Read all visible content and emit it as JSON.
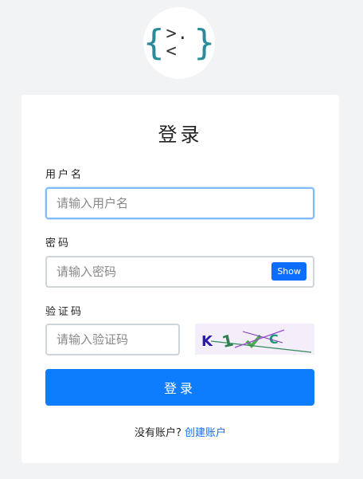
{
  "logo": {
    "left_brace": "{",
    "face": ">.<",
    "right_brace": "}",
    "brace_color": "#2a8c9a"
  },
  "form": {
    "title": "登录",
    "username": {
      "label": "用户名",
      "placeholder": "请输入用户名"
    },
    "password": {
      "label": "密码",
      "placeholder": "请输入密码",
      "show_label": "Show"
    },
    "captcha": {
      "label": "验证码",
      "placeholder": "请输入验证码",
      "image_text": "K 1 ✓ C"
    },
    "submit_label": "登录",
    "footer": {
      "prompt": "没有账户?",
      "link": "创建账户"
    }
  },
  "colors": {
    "primary": "#0d7cfd",
    "background": "#f2f3f5",
    "focus": "#80bdff"
  }
}
